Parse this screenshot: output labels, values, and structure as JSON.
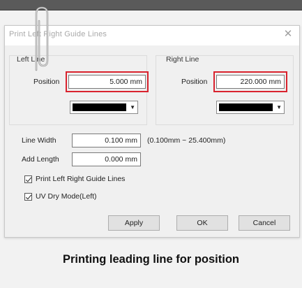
{
  "window": {
    "title": "Print Left Right Guide Lines",
    "close_glyph": "✕"
  },
  "left_line": {
    "group_label": "Left Line",
    "position_label": "Position",
    "position_value": "5.000",
    "position_unit": "mm",
    "color": "#000000",
    "dropdown_icon": "chevron-down-icon"
  },
  "right_line": {
    "group_label": "Right Line",
    "position_label": "Position",
    "position_value": "220.000",
    "position_unit": "mm",
    "color": "#000000",
    "dropdown_icon": "chevron-down-icon"
  },
  "line_width": {
    "label": "Line Width",
    "value": "0.100",
    "unit": "mm",
    "range_hint": "(0.100mm ~ 25.400mm)"
  },
  "add_length": {
    "label": "Add Length",
    "value": "0.000",
    "unit": "mm"
  },
  "options": [
    {
      "label": "Print Left Right Guide Lines",
      "checked": true
    },
    {
      "label": "UV Dry Mode(Left)",
      "checked": true
    }
  ],
  "buttons": {
    "apply": "Apply",
    "ok": "OK",
    "cancel": "Cancel"
  },
  "caption": "Printing leading line for position",
  "highlight_color": "#d9232e"
}
